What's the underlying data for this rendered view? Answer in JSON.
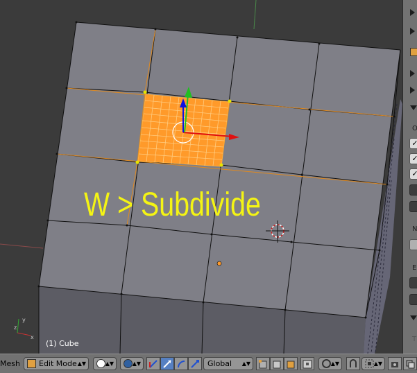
{
  "viewport": {
    "overlay_text": "W > Subdivide",
    "object_info": "(1) Cube",
    "colors": {
      "background": "#3b3b3b",
      "face": "#7f7f87",
      "side_face": "#5a5a62",
      "edge": "#101010",
      "selected": "#ff9a2a",
      "overlay_text": "#f4f414"
    }
  },
  "properties_panel": {
    "letters": [
      "O",
      "N",
      "E",
      "T"
    ]
  },
  "header": {
    "editor_label": "Mesh",
    "mode": "Edit Mode",
    "transform_orientation": "Global",
    "icons": [
      "edit-mode-icon",
      "viewport-shading-icon",
      "pivot-point-icon",
      "manipulator-icon",
      "translate-icon",
      "rotate-icon",
      "scale-icon",
      "vertex-select-icon",
      "edge-select-icon",
      "face-select-icon",
      "occlude-icon",
      "proportional-edit-icon",
      "snap-icon",
      "snap-target-icon",
      "render-icon",
      "copy-icon"
    ]
  }
}
